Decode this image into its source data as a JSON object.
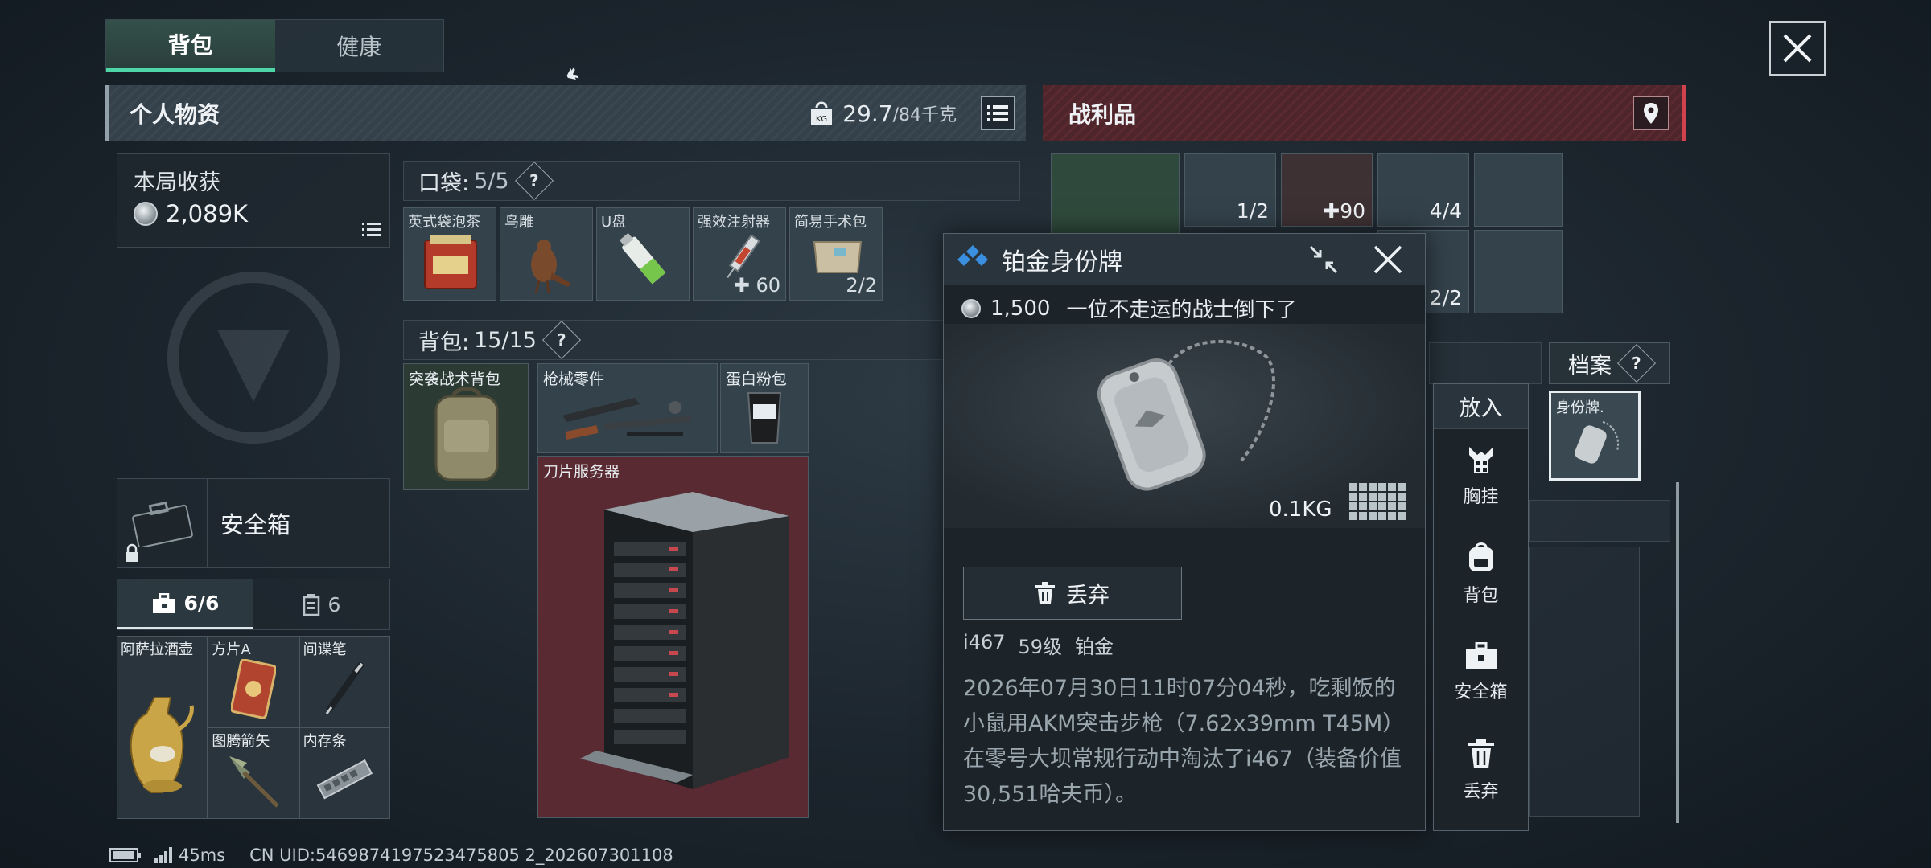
{
  "tabs": [
    "背包",
    "健康"
  ],
  "left_panel": {
    "title": "个人物资",
    "weight_current": "29.7",
    "weight_max": "/84千克"
  },
  "right_panel": {
    "title": "战利品"
  },
  "earnings": {
    "label": "本局收获",
    "value": "2,089K"
  },
  "safe_box": {
    "label": "安全箱"
  },
  "sub_tabs": [
    {
      "label": "6/6"
    },
    {
      "label": "6"
    }
  ],
  "secure_items": [
    {
      "name": "阿萨拉酒壶"
    },
    {
      "name": "方片A"
    },
    {
      "name": "间谍笔"
    },
    {
      "name": "图腾箭矢"
    },
    {
      "name": "内存条"
    }
  ],
  "pocket": {
    "label": "口袋:",
    "count": "5/5",
    "items": [
      {
        "name": "英式袋泡茶",
        "count": ""
      },
      {
        "name": "鸟雕",
        "count": ""
      },
      {
        "name": "U盘",
        "count": ""
      },
      {
        "name": "强效注射器",
        "count": "60"
      },
      {
        "name": "简易手术包",
        "count": "2/2"
      }
    ]
  },
  "backpack": {
    "label": "背包:",
    "count": "15/15",
    "items": [
      {
        "name": "突袭战术背包"
      },
      {
        "name": "枪械零件"
      },
      {
        "name": "蛋白粉包"
      },
      {
        "name": "刀片服务器"
      }
    ]
  },
  "loot_counts": [
    "1/2",
    "90",
    "4/4",
    "2/2"
  ],
  "archive": {
    "label": "档案"
  },
  "dogtag_slot": {
    "name": "身份牌."
  },
  "popup": {
    "title": "铂金身份牌",
    "price": "1,500",
    "subtitle": "一位不走运的战士倒下了",
    "weight": "0.1KG",
    "discard": "丢弃",
    "meta": [
      "i467",
      "59级",
      "铂金"
    ],
    "description": "2026年07月30日11时07分04秒，吃剩饭的小鼠用AKM突击步枪（7.62x39mm T45M）在零号大坝常规行动中淘汰了i467（装备价值30,551哈夫币）。"
  },
  "side_menu": {
    "header": "放入",
    "items": [
      "胸挂",
      "背包",
      "安全箱",
      "丢弃"
    ]
  },
  "status_bar": {
    "ping": "45ms",
    "uid": "CN UID:5469874197523475805 2_202607301108"
  },
  "colors": {
    "accent_green": "#4fd6a6",
    "loot_red": "#d0434e",
    "server_red": "#6e2a32"
  },
  "question_mark": "?"
}
